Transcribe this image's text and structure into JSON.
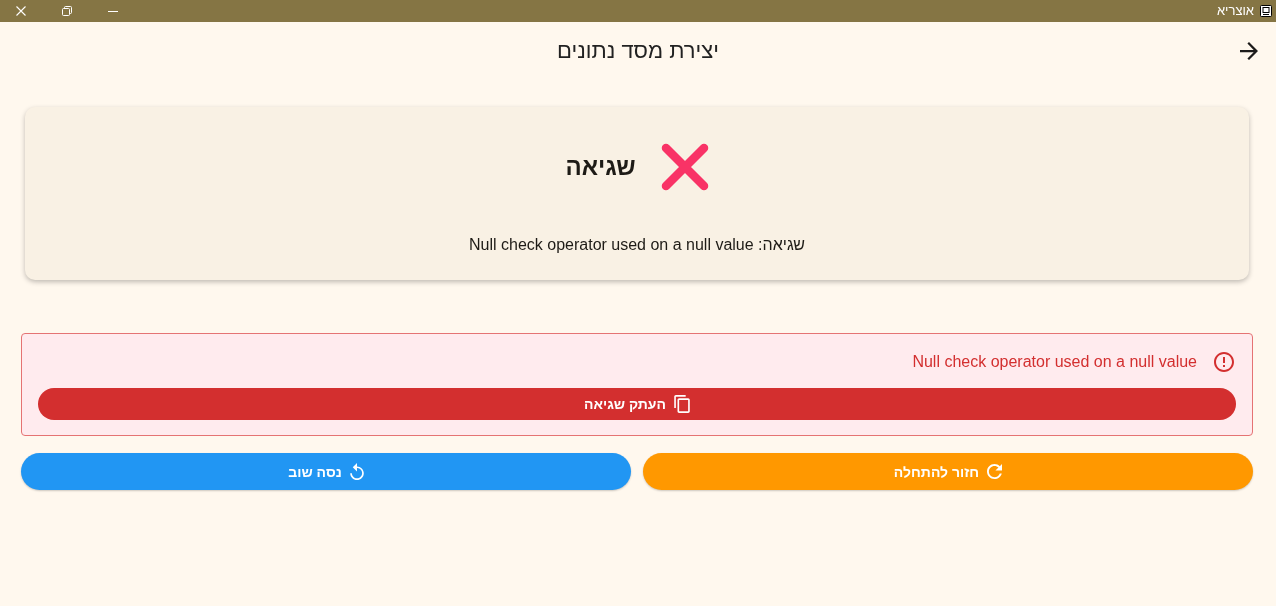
{
  "window": {
    "title": "אוצריא"
  },
  "header": {
    "title": "יצירת מסד נתונים"
  },
  "status_card": {
    "kind": "error",
    "title": "שגיאה",
    "message": "שגיאה: Null check operator used on a null value"
  },
  "error_panel": {
    "message": "Null check operator used on a null value",
    "copy_button": "העתק שגיאה"
  },
  "actions": [
    {
      "kind": "restart",
      "label": "חזור להתחלה",
      "color": "#ff9800"
    },
    {
      "kind": "retry",
      "label": "נסה שוב",
      "color": "#2196f3"
    }
  ]
}
